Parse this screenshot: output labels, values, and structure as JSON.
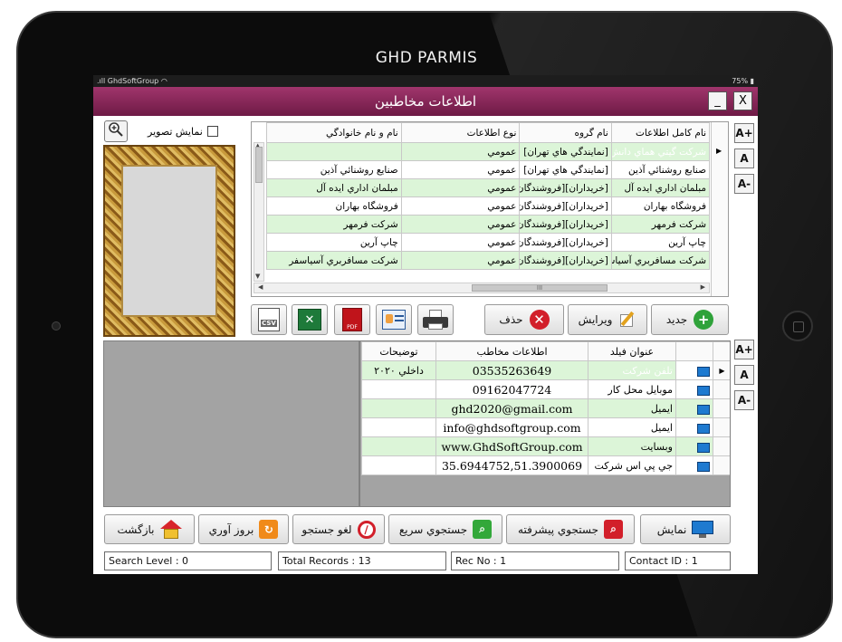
{
  "device": {
    "brand": "GHD PARMIS"
  },
  "status_bar": {
    "carrier": "GhdSoftGroup",
    "battery": "75%"
  },
  "window": {
    "title": "اطلاعات مخاطبين",
    "minimize": "_",
    "close": "X"
  },
  "image_toggle": {
    "label": "نمايش تصوير",
    "checked": false
  },
  "contacts_grid": {
    "columns": [
      "نام کامل اطلاعات",
      "نام گروه",
      "نوع اطلاعات",
      "نام و نام خانوادگي"
    ],
    "rows": [
      [
        "شرکت گيتي هماي دانش",
        "[نمايندگي هاي تهران]",
        "عمومي",
        ""
      ],
      [
        "صنايع روشنائي آذين",
        "[نمايندگي هاي تهران]",
        "عمومي",
        "صنايع روشنائي آذين"
      ],
      [
        "مبلمان اداري ايده آل",
        "[خريداران][فروشندگان]",
        "عمومي",
        "مبلمان اداري ايده آل"
      ],
      [
        "فروشگاه بهاران",
        "[خريداران][فروشندگان]",
        "عمومي",
        "فروشگاه بهاران"
      ],
      [
        "شرکت فرمهر",
        "[خريداران][فروشندگان]",
        "عمومي",
        "شرکت فرمهر"
      ],
      [
        "چاپ آرين",
        "[خريداران][فروشندگان]",
        "عمومي",
        "چاپ آرين"
      ],
      [
        "شرکت مسافربري آسياسفر",
        "[خريداران][فروشندگان]",
        "عمومي",
        "شرکت مسافربري آسياسفر"
      ]
    ]
  },
  "font_buttons": {
    "increase": "A+",
    "normal": "A",
    "decrease": "A-"
  },
  "scroll_label": "III",
  "actions": {
    "new": "جديد",
    "edit": "ويرايش",
    "delete": "حذف",
    "csv": "CSV",
    "pdf": "PDF"
  },
  "details_grid": {
    "columns": [
      "عنوان فيلد",
      "اطلاعات مخاطب",
      "توضيحات"
    ],
    "rows": [
      [
        "تلفن شرکت",
        "03535263649",
        "داخلي ۲۰۲۰"
      ],
      [
        "موبايل محل کار",
        "09162047724",
        ""
      ],
      [
        "ايميل",
        "ghd2020@gmail.com",
        ""
      ],
      [
        "ايميل",
        "info@ghdsoftgroup.com",
        ""
      ],
      [
        "وبسايت",
        "www.GhdSoftGroup.com",
        ""
      ],
      [
        "جي پي اس شرکت",
        "35.6944752,51.3900069",
        ""
      ]
    ]
  },
  "bottom_buttons": {
    "show": "نمايش",
    "advanced_search": "جستجوي پيشرفته",
    "quick_search": "جستجوي سريع",
    "cancel_search": "لغو جستجو",
    "refresh": "بروز آوري",
    "back": "بازگشت"
  },
  "status_fields": {
    "search_level": "Search Level : 0",
    "total_records": "Total Records : 13",
    "rec_no": "Rec No : 1",
    "contact_id": "Contact ID : 1"
  },
  "colors": {
    "title_bar": "#8a2458",
    "selected_row": "#1a3a7a",
    "alt_row": "#dcf5d8"
  }
}
